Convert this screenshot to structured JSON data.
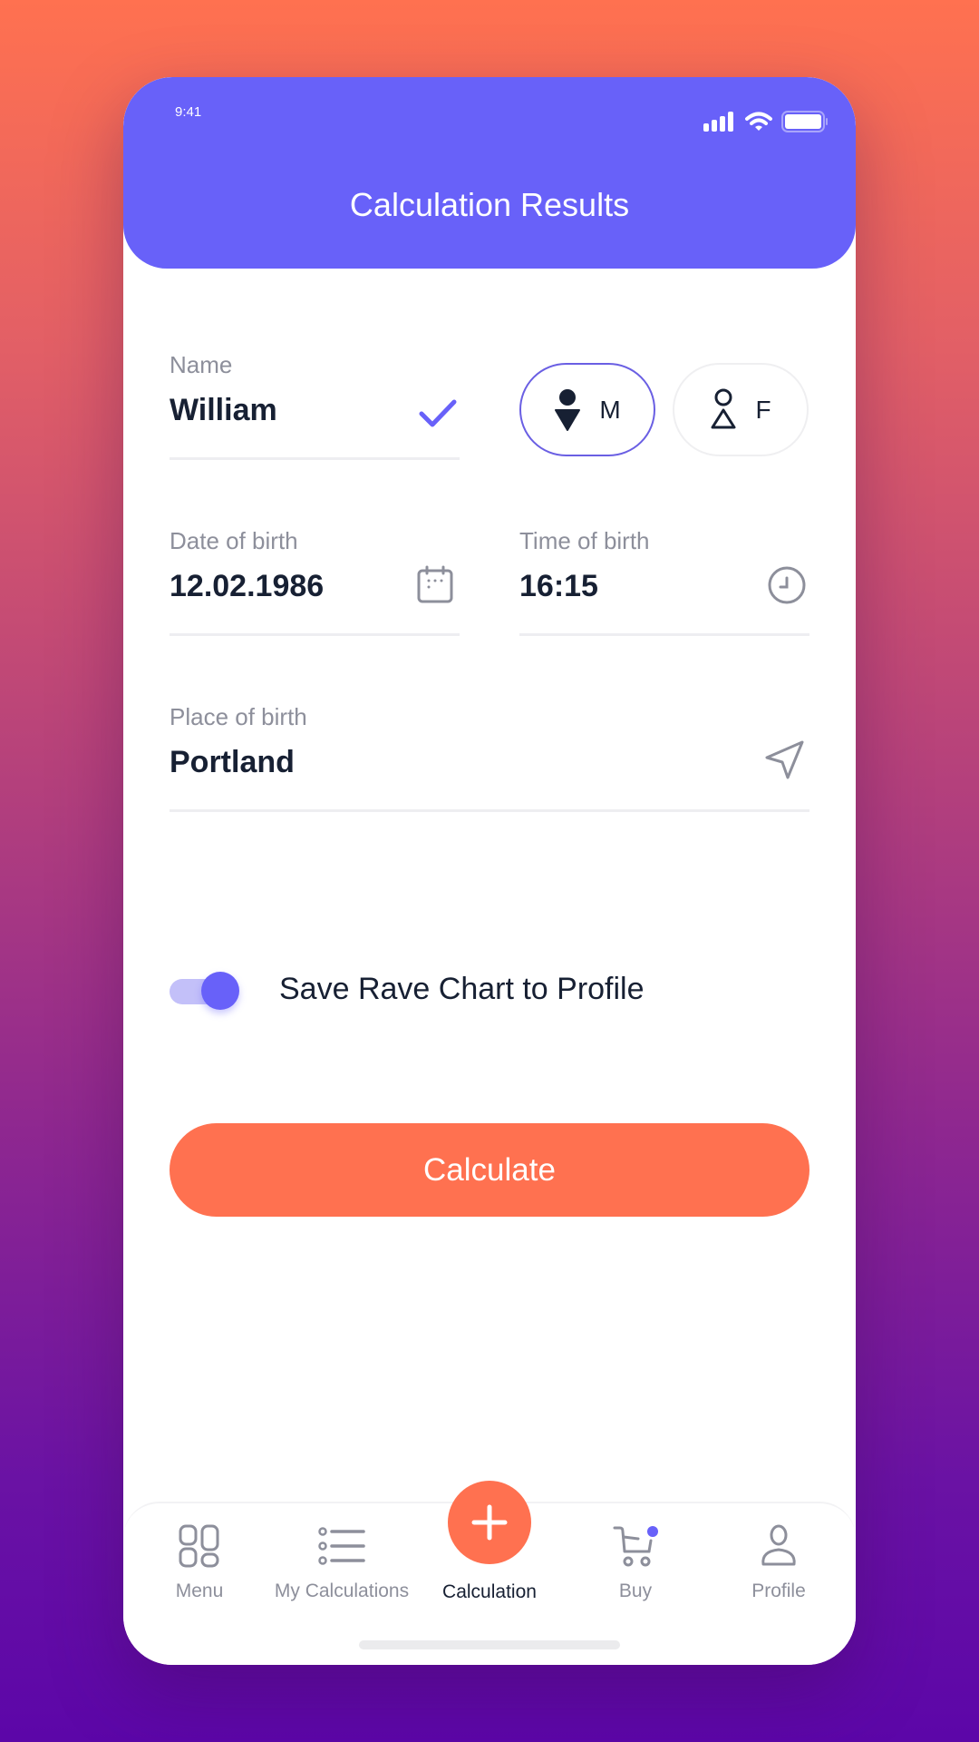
{
  "status_bar": {
    "time": "9:41",
    "icons": [
      "cellular-signal-icon",
      "wifi-icon",
      "battery-icon"
    ]
  },
  "header": {
    "title": "Calculation Results"
  },
  "form": {
    "name": {
      "label": "Name",
      "value": "William",
      "icon": "checkmark-icon"
    },
    "gender": {
      "selected": "M",
      "options": [
        {
          "label": "M",
          "icon": "male-icon"
        },
        {
          "label": "F",
          "icon": "female-icon"
        }
      ]
    },
    "date_of_birth": {
      "label": "Date of birth",
      "value": "12.02.1986",
      "icon": "calendar-icon"
    },
    "time_of_birth": {
      "label": "Time of birth",
      "value": "16:15",
      "icon": "clock-icon"
    },
    "place_of_birth": {
      "label": "Place of birth",
      "value": "Portland",
      "icon": "location-arrow-icon"
    },
    "save_toggle": {
      "label": "Save Rave Chart to Profile",
      "checked": true
    },
    "submit_label": "Calculate"
  },
  "tabbar": {
    "items": [
      {
        "label": "Menu",
        "icon": "grid-icon"
      },
      {
        "label": "My Calculations",
        "icon": "list-icon"
      },
      {
        "label": "Calculation",
        "icon": "plus-icon",
        "active": true
      },
      {
        "label": "Buy",
        "icon": "cart-icon",
        "badge": true
      },
      {
        "label": "Profile",
        "icon": "user-icon"
      }
    ]
  },
  "colors": {
    "primary": "#6861f9",
    "accent": "#ff7150",
    "text": "#172033",
    "muted": "#8d8f9b"
  }
}
